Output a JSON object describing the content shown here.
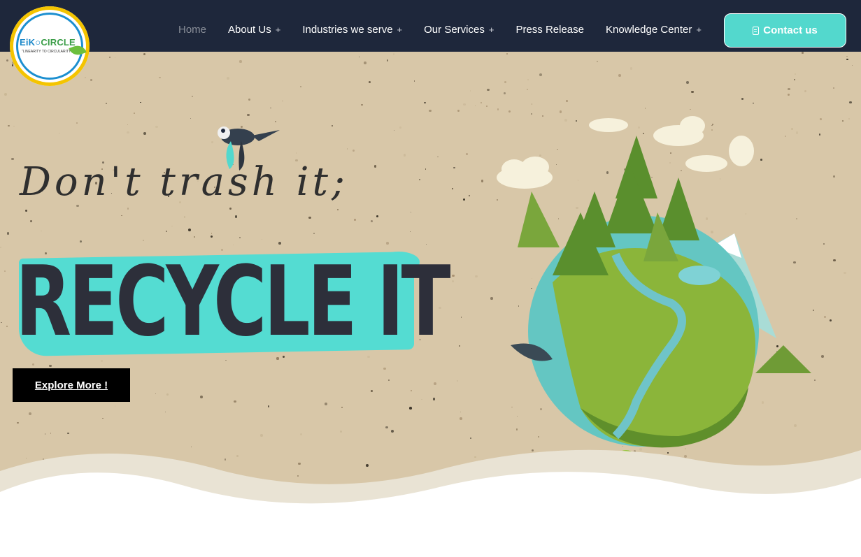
{
  "header": {
    "logo": {
      "name": "EiKO CIRCLE",
      "name_part1": "EiK",
      "name_part2": "CIRCLE",
      "tagline": "\"LINEARITY TO CIRCULARITY\""
    },
    "nav": [
      {
        "label": "Home",
        "has_submenu": false,
        "active": true
      },
      {
        "label": "About Us",
        "has_submenu": true
      },
      {
        "label": "Industries we serve",
        "has_submenu": true
      },
      {
        "label": "Our Services",
        "has_submenu": true
      },
      {
        "label": "Press Release",
        "has_submenu": false
      },
      {
        "label": "Knowledge Center",
        "has_submenu": true
      }
    ],
    "submenu_marker": "+",
    "contact_button": {
      "label": "Contact us",
      "icon": "document-icon"
    }
  },
  "hero": {
    "script_text": "Don't trash it;",
    "headline": "RECYCLE IT",
    "cta_label": "Explore More !",
    "illustration": "earth-globe-with-trees-and-river",
    "bird": "flying-bird-icon"
  },
  "colors": {
    "header_bg": "#1e273b",
    "accent_teal": "#53d8cd",
    "paper_bg": "#d8c7a8",
    "headline_text": "#2d2f3a",
    "cta_bg": "#000000"
  }
}
